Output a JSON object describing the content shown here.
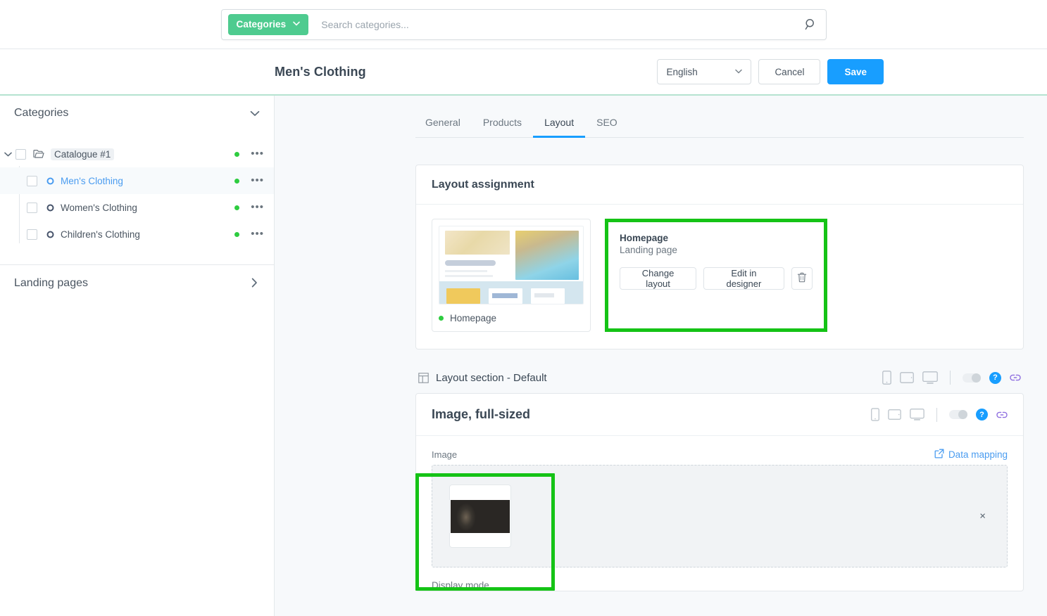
{
  "search": {
    "button_label": "Categories",
    "placeholder": "Search categories...",
    "icon": "search-icon",
    "chevron": "chevron-down-icon"
  },
  "header": {
    "title": "Men's Clothing",
    "language": "English",
    "cancel_label": "Cancel",
    "save_label": "Save",
    "accent_blue": "#189eff",
    "accent_green": "#4ecb8f"
  },
  "sidebar": {
    "categories_section": {
      "title": "Categories",
      "expanded": true,
      "chevron": "chevron-down-icon"
    },
    "tree": [
      {
        "label": "Catalogue #1",
        "icon": "folder-open-icon",
        "level": 0,
        "selected": false,
        "status": "active",
        "menu": "ellipsis-icon"
      },
      {
        "label": "Men's Clothing",
        "icon": "circle-ring-icon",
        "level": 1,
        "selected": true,
        "status": "active",
        "menu": "ellipsis-icon"
      },
      {
        "label": "Women's Clothing",
        "icon": "circle-ring-icon",
        "level": 1,
        "selected": false,
        "status": "active",
        "menu": "ellipsis-icon"
      },
      {
        "label": "Children's Clothing",
        "icon": "circle-ring-icon",
        "level": 1,
        "selected": false,
        "status": "active",
        "menu": "ellipsis-icon"
      }
    ],
    "landing_pages": {
      "title": "Landing pages",
      "chevron": "chevron-right-icon"
    },
    "status_dot_color": "#2ecc40"
  },
  "tabs": [
    {
      "label": "General",
      "active": false
    },
    {
      "label": "Products",
      "active": false
    },
    {
      "label": "Layout",
      "active": true
    },
    {
      "label": "SEO",
      "active": false
    }
  ],
  "layout_assignment": {
    "card_title": "Layout assignment",
    "preview": {
      "caption": "Homepage",
      "status": "active"
    },
    "assigned": {
      "name": "Homepage",
      "type": "Landing page",
      "change_layout_label": "Change layout",
      "edit_in_designer_label": "Edit in designer",
      "delete_icon": "trash-icon",
      "highlighted": true,
      "highlight_color": "#15c316"
    }
  },
  "layout_section": {
    "icon": "layout-columns-icon",
    "title": "Layout section - Default",
    "devices": [
      "mobile-icon",
      "tablet-icon",
      "desktop-icon"
    ],
    "toggle": "visibility-toggle",
    "help_badge": "?",
    "link_icon": "link-icon"
  },
  "block": {
    "title": "Image, full-sized",
    "devices": [
      "mobile-icon",
      "tablet-icon",
      "desktop-icon"
    ],
    "toggle": "visibility-toggle",
    "help_badge": "?",
    "link_icon": "link-icon",
    "image_field": {
      "label": "Image",
      "highlighted": true,
      "highlight_color": "#15c316",
      "data_mapping_label": "Data mapping",
      "data_mapping_icon": "external-link-icon",
      "remove_label": "×",
      "thumbnail": "jackets-photo"
    },
    "display_mode_label": "Display mode"
  }
}
